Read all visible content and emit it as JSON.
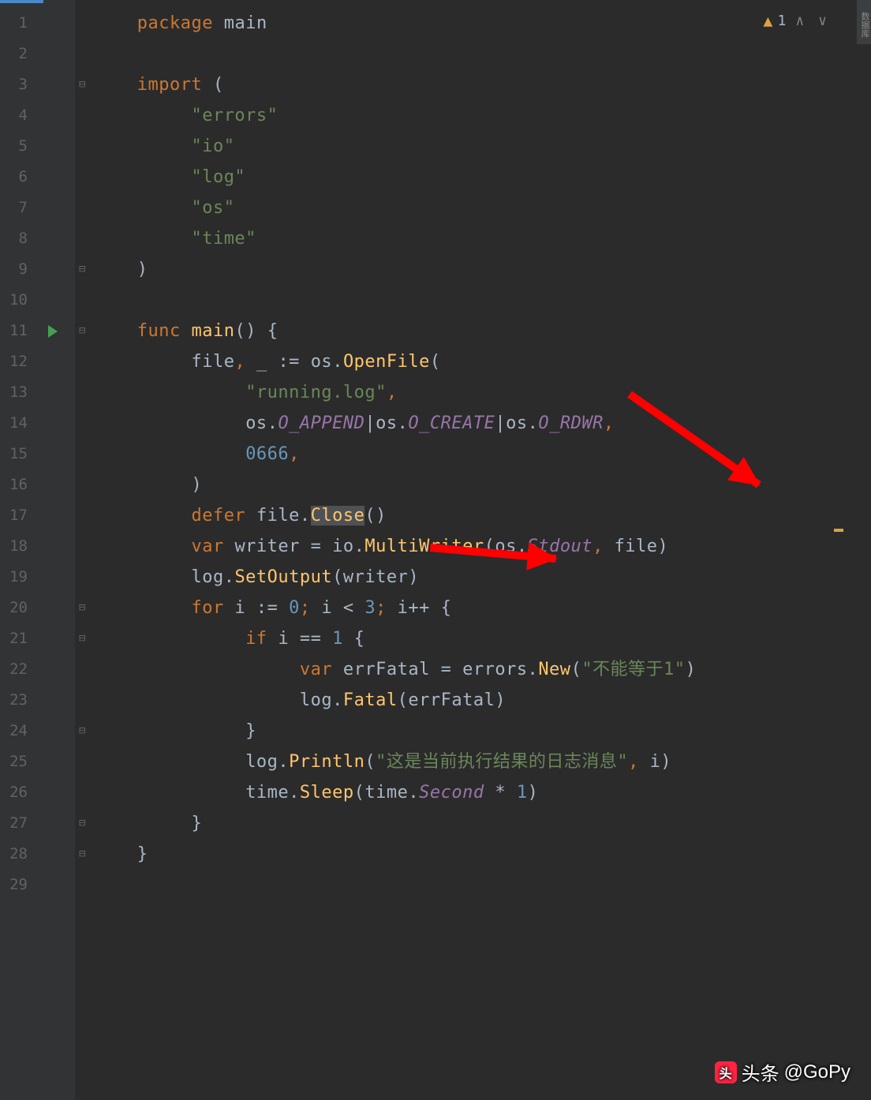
{
  "warnings": {
    "count": "1"
  },
  "attribution": {
    "prefix": "头条",
    "handle": "@GoPy"
  },
  "sidebar_label": "数据库",
  "lines": [
    {
      "n": "1",
      "indent": 1,
      "tokens": [
        {
          "t": "package ",
          "c": "kw"
        },
        {
          "t": "main",
          "c": "ident"
        }
      ]
    },
    {
      "n": "2",
      "indent": 0,
      "tokens": []
    },
    {
      "n": "3",
      "indent": 1,
      "tokens": [
        {
          "t": "import ",
          "c": "kw"
        },
        {
          "t": "(",
          "c": "punct"
        }
      ],
      "fold": true
    },
    {
      "n": "4",
      "indent": 2,
      "tokens": [
        {
          "t": "\"errors\"",
          "c": "str"
        }
      ]
    },
    {
      "n": "5",
      "indent": 2,
      "tokens": [
        {
          "t": "\"io\"",
          "c": "str"
        }
      ]
    },
    {
      "n": "6",
      "indent": 2,
      "tokens": [
        {
          "t": "\"log\"",
          "c": "str"
        }
      ]
    },
    {
      "n": "7",
      "indent": 2,
      "tokens": [
        {
          "t": "\"os\"",
          "c": "str"
        }
      ]
    },
    {
      "n": "8",
      "indent": 2,
      "tokens": [
        {
          "t": "\"time\"",
          "c": "str"
        }
      ]
    },
    {
      "n": "9",
      "indent": 1,
      "tokens": [
        {
          "t": ")",
          "c": "punct"
        }
      ],
      "fold": true
    },
    {
      "n": "10",
      "indent": 0,
      "tokens": []
    },
    {
      "n": "11",
      "indent": 1,
      "tokens": [
        {
          "t": "func ",
          "c": "kw"
        },
        {
          "t": "main",
          "c": "funcname"
        },
        {
          "t": "() {",
          "c": "punct"
        }
      ],
      "fold": true,
      "run": true
    },
    {
      "n": "12",
      "indent": 2,
      "tokens": [
        {
          "t": "file",
          "c": "ident"
        },
        {
          "t": ", ",
          "c": "comma"
        },
        {
          "t": "_ ",
          "c": "ident"
        },
        {
          "t": ":= ",
          "c": "punct"
        },
        {
          "t": "os",
          "c": "ident"
        },
        {
          "t": ".",
          "c": "punct"
        },
        {
          "t": "OpenFile",
          "c": "hl-yellow"
        },
        {
          "t": "(",
          "c": "punct"
        }
      ]
    },
    {
      "n": "13",
      "indent": 3,
      "tokens": [
        {
          "t": "\"running.log\"",
          "c": "str"
        },
        {
          "t": ",",
          "c": "comma"
        }
      ]
    },
    {
      "n": "14",
      "indent": 3,
      "tokens": [
        {
          "t": "os",
          "c": "ident"
        },
        {
          "t": ".",
          "c": "punct"
        },
        {
          "t": "O_APPEND",
          "c": "const"
        },
        {
          "t": "|",
          "c": "punct"
        },
        {
          "t": "os",
          "c": "ident"
        },
        {
          "t": ".",
          "c": "punct"
        },
        {
          "t": "O_CREATE",
          "c": "const"
        },
        {
          "t": "|",
          "c": "punct"
        },
        {
          "t": "os",
          "c": "ident"
        },
        {
          "t": ".",
          "c": "punct"
        },
        {
          "t": "O_RDWR",
          "c": "const"
        },
        {
          "t": ",",
          "c": "comma"
        }
      ]
    },
    {
      "n": "15",
      "indent": 3,
      "tokens": [
        {
          "t": "0666",
          "c": "num"
        },
        {
          "t": ",",
          "c": "comma"
        }
      ]
    },
    {
      "n": "16",
      "indent": 2,
      "tokens": [
        {
          "t": ")",
          "c": "punct"
        }
      ]
    },
    {
      "n": "17",
      "indent": 2,
      "tokens": [
        {
          "t": "defer ",
          "c": "kw"
        },
        {
          "t": "file.",
          "c": "ident"
        },
        {
          "t": "Close",
          "c": "hl-yellow highlight-box"
        },
        {
          "t": "()",
          "c": "punct"
        }
      ]
    },
    {
      "n": "18",
      "indent": 2,
      "tokens": [
        {
          "t": "var ",
          "c": "kw"
        },
        {
          "t": "writer = io.",
          "c": "ident"
        },
        {
          "t": "MultiWriter",
          "c": "hl-yellow"
        },
        {
          "t": "(os.",
          "c": "ident"
        },
        {
          "t": "Stdout",
          "c": "const"
        },
        {
          "t": ", ",
          "c": "comma"
        },
        {
          "t": "file)",
          "c": "ident"
        }
      ]
    },
    {
      "n": "19",
      "indent": 2,
      "tokens": [
        {
          "t": "log.",
          "c": "ident"
        },
        {
          "t": "SetOutput",
          "c": "hl-yellow"
        },
        {
          "t": "(writer)",
          "c": "ident"
        }
      ]
    },
    {
      "n": "20",
      "indent": 2,
      "tokens": [
        {
          "t": "for ",
          "c": "kw"
        },
        {
          "t": "i := ",
          "c": "ident"
        },
        {
          "t": "0",
          "c": "num"
        },
        {
          "t": "; ",
          "c": "comma"
        },
        {
          "t": "i < ",
          "c": "ident"
        },
        {
          "t": "3",
          "c": "num"
        },
        {
          "t": "; ",
          "c": "comma"
        },
        {
          "t": "i++ {",
          "c": "ident"
        }
      ],
      "fold": true
    },
    {
      "n": "21",
      "indent": 3,
      "tokens": [
        {
          "t": "if ",
          "c": "kw"
        },
        {
          "t": "i == ",
          "c": "ident"
        },
        {
          "t": "1 ",
          "c": "num"
        },
        {
          "t": "{",
          "c": "punct"
        }
      ],
      "fold": true
    },
    {
      "n": "22",
      "indent": 4,
      "tokens": [
        {
          "t": "var ",
          "c": "kw"
        },
        {
          "t": "errFatal = errors.",
          "c": "ident"
        },
        {
          "t": "New",
          "c": "hl-yellow"
        },
        {
          "t": "(",
          "c": "punct"
        },
        {
          "t": "\"不能等于1\"",
          "c": "str"
        },
        {
          "t": ")",
          "c": "punct"
        }
      ]
    },
    {
      "n": "23",
      "indent": 4,
      "tokens": [
        {
          "t": "log.",
          "c": "ident"
        },
        {
          "t": "Fatal",
          "c": "hl-yellow"
        },
        {
          "t": "(errFatal)",
          "c": "ident"
        }
      ]
    },
    {
      "n": "24",
      "indent": 3,
      "tokens": [
        {
          "t": "}",
          "c": "punct"
        }
      ],
      "fold": true
    },
    {
      "n": "25",
      "indent": 3,
      "tokens": [
        {
          "t": "log.",
          "c": "ident"
        },
        {
          "t": "Println",
          "c": "hl-yellow"
        },
        {
          "t": "(",
          "c": "punct"
        },
        {
          "t": "\"这是当前执行结果的日志消息\"",
          "c": "str"
        },
        {
          "t": ", ",
          "c": "comma"
        },
        {
          "t": "i)",
          "c": "ident"
        }
      ]
    },
    {
      "n": "26",
      "indent": 3,
      "tokens": [
        {
          "t": "time.",
          "c": "ident"
        },
        {
          "t": "Sleep",
          "c": "hl-yellow"
        },
        {
          "t": "(time.",
          "c": "ident"
        },
        {
          "t": "Second",
          "c": "const"
        },
        {
          "t": " * ",
          "c": "ident"
        },
        {
          "t": "1",
          "c": "num"
        },
        {
          "t": ")",
          "c": "punct"
        }
      ]
    },
    {
      "n": "27",
      "indent": 2,
      "tokens": [
        {
          "t": "}",
          "c": "punct"
        }
      ],
      "fold": true
    },
    {
      "n": "28",
      "indent": 1,
      "tokens": [
        {
          "t": "}",
          "c": "punct"
        }
      ],
      "fold": true
    },
    {
      "n": "29",
      "indent": 0,
      "tokens": []
    }
  ]
}
